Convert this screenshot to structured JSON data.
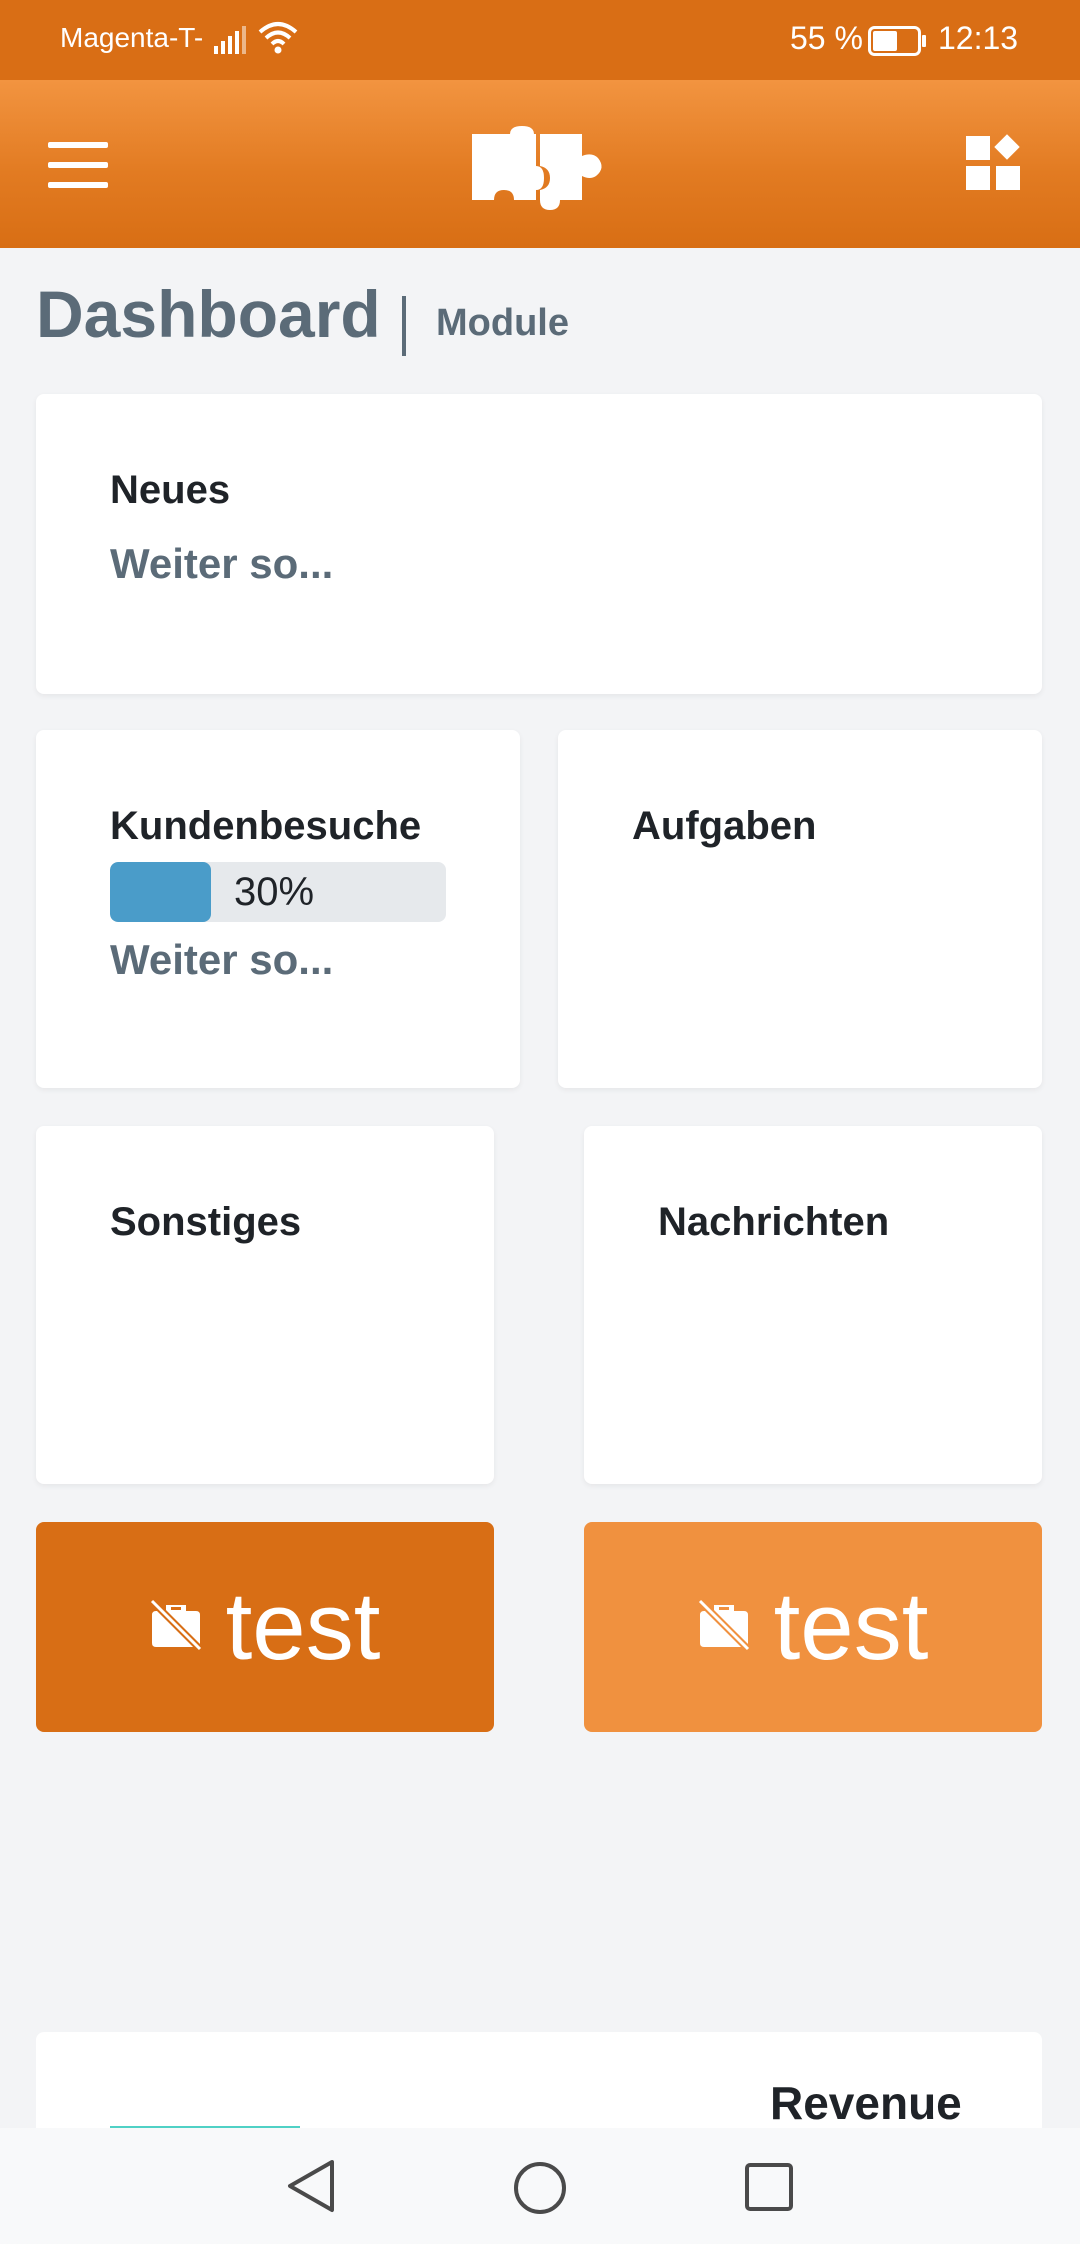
{
  "status_bar": {
    "carrier": "Magenta-T-",
    "battery_percent": "55 %",
    "time": "12:13",
    "battery_level": 0.55
  },
  "header": {
    "logo": "puzzle-logo",
    "menu_icon": "hamburger-icon",
    "modules_icon": "widgets-icon"
  },
  "page": {
    "title": "Dashboard",
    "subtitle": "Module"
  },
  "cards": {
    "neues": {
      "title": "Neues",
      "subtitle": "Weiter so..."
    },
    "kundenbesuche": {
      "title": "Kundenbesuche",
      "progress_text": "30%",
      "progress_value": 0.3,
      "subtitle": "Weiter so..."
    },
    "aufgaben": {
      "title": "Aufgaben"
    },
    "sonstiges": {
      "title": "Sonstiges"
    },
    "nachrichten": {
      "title": "Nachrichten"
    }
  },
  "tiles": [
    {
      "label": "test",
      "icon": "work-off-icon",
      "color": "#d86e15"
    },
    {
      "label": "test",
      "icon": "work-off-icon",
      "color": "#f0913f"
    }
  ],
  "revenue": {
    "title": "Revenue"
  },
  "colors": {
    "brand_orange": "#d96e15",
    "brand_orange_light": "#f0913f",
    "progress_blue": "#4a9cc9",
    "text_slate": "#5b6b78",
    "background": "#f3f4f6"
  }
}
